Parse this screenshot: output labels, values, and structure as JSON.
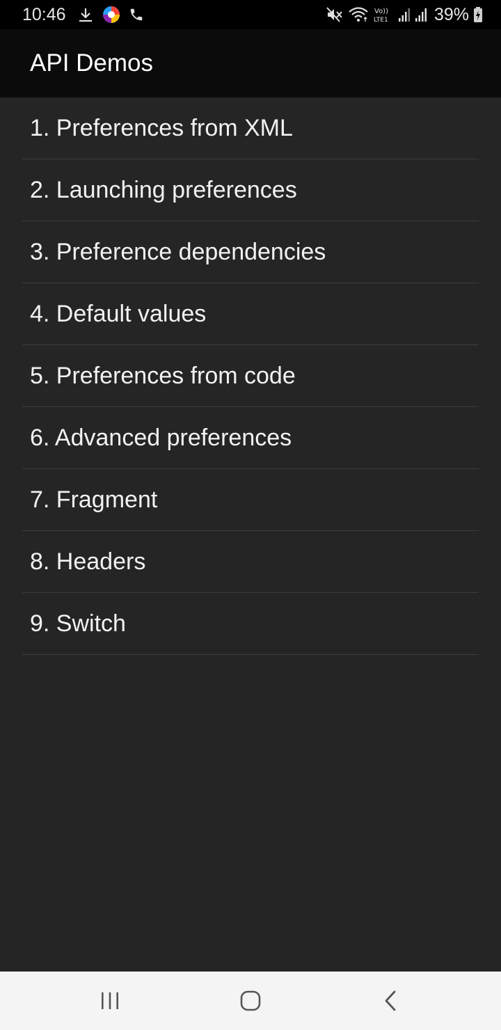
{
  "status_bar": {
    "time": "10:46",
    "battery_percent": "39%",
    "network_label": "LTE1",
    "left_icons": [
      "download-icon",
      "app-notification-icon",
      "phone-call-icon"
    ],
    "right_icons": [
      "mute-icon",
      "wifi-icon",
      "volte-icon",
      "signal-icon",
      "signal-icon",
      "battery-charging-icon"
    ]
  },
  "app_bar": {
    "title": "API Demos"
  },
  "list": {
    "items": [
      {
        "label": "1. Preferences from XML"
      },
      {
        "label": "2. Launching preferences"
      },
      {
        "label": "3. Preference dependencies"
      },
      {
        "label": "4. Default values"
      },
      {
        "label": "5. Preferences from code"
      },
      {
        "label": "6. Advanced preferences"
      },
      {
        "label": "7. Fragment"
      },
      {
        "label": "8. Headers"
      },
      {
        "label": "9. Switch"
      }
    ]
  },
  "nav_bar": {
    "buttons": [
      "recent-apps-icon",
      "home-icon",
      "back-icon"
    ]
  },
  "colors": {
    "background": "#252525",
    "app_bar": "#0b0b0b",
    "status_bar": "#000000",
    "nav_bar": "#f4f4f4",
    "divider": "#3d3d3d",
    "text": "#f2f2f2"
  }
}
